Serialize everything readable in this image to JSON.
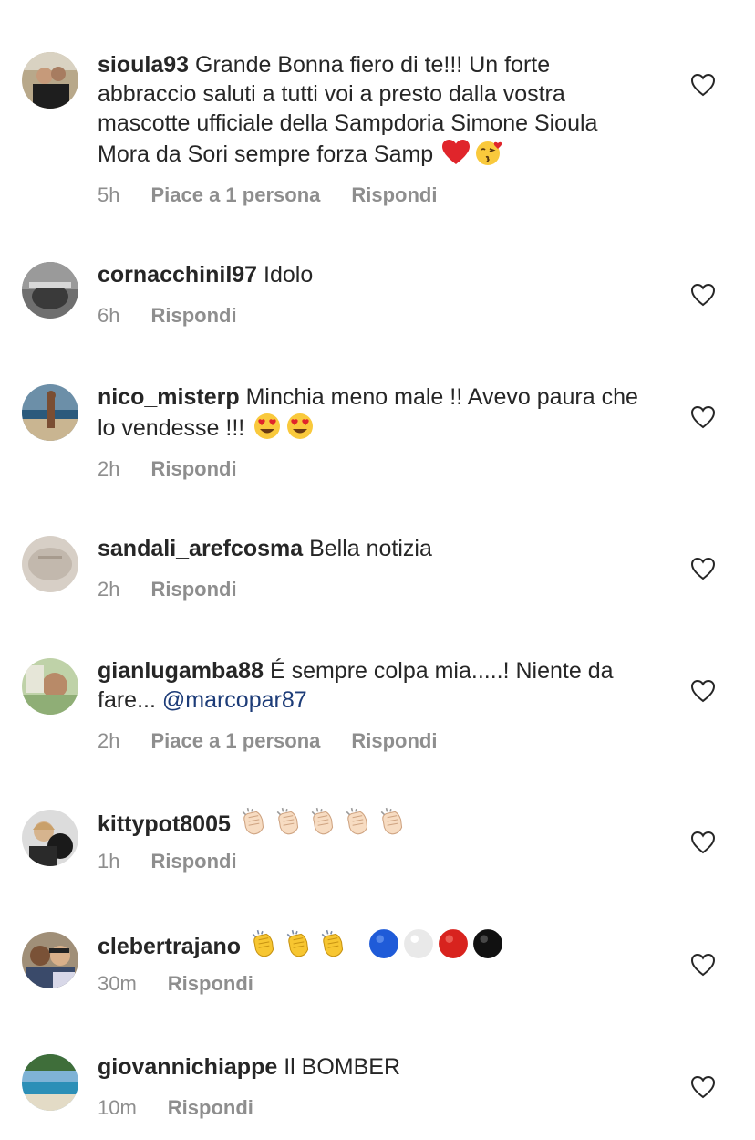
{
  "comments": [
    {
      "username": "sioula93",
      "text": "Grande Bonna fiero di te!!! Un forte abbraccio saluti a tutti voi a presto dalla vostra mascotte ufficiale della Sampdoria Simone Sioula Mora da Sori sempre forza Samp",
      "emojis": [
        "red-heart",
        "face-blowing-kiss"
      ],
      "time": "5h",
      "likes": "Piace a 1 persona",
      "reply": "Rispondi"
    },
    {
      "username": "cornacchinil97",
      "text": "Idolo",
      "time": "6h",
      "reply": "Rispondi"
    },
    {
      "username": "nico_misterp",
      "text": "Minchia meno male !! Avevo paura che lo vendesse !!!",
      "emojis": [
        "heart-eyes-face",
        "heart-eyes-face"
      ],
      "time": "2h",
      "reply": "Rispondi"
    },
    {
      "username": "sandali_arefcosma",
      "text": "Bella notizia",
      "time": "2h",
      "reply": "Rispondi"
    },
    {
      "username": "gianlugamba88",
      "text": "É sempre colpa mia.....! Niente da fare...",
      "mention": "@marcopar87",
      "time": "2h",
      "likes": "Piace a 1 persona",
      "reply": "Rispondi"
    },
    {
      "username": "kittypot8005",
      "emojis": [
        "clap-light",
        "clap-light",
        "clap-light",
        "clap-light",
        "clap-light"
      ],
      "time": "1h",
      "reply": "Rispondi"
    },
    {
      "username": "clebertrajano",
      "emojis": [
        "clap-yellow",
        "clap-yellow",
        "clap-yellow",
        "blue-circle",
        "white-circle",
        "red-circle",
        "black-circle"
      ],
      "time": "30m",
      "reply": "Rispondi"
    },
    {
      "username": "giovannichiappe",
      "text": "Il BOMBER",
      "time": "10m",
      "reply": "Rispondi"
    }
  ],
  "icons": {
    "like": "heart-outline-icon"
  },
  "colors": {
    "mention": "#1d3c78",
    "meta": "#8e8e8e",
    "text": "#262626"
  }
}
